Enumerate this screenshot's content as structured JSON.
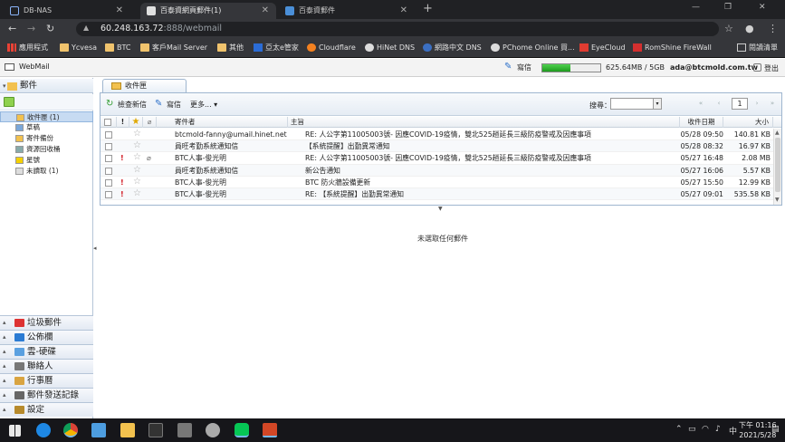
{
  "browser": {
    "tabs": [
      {
        "label": "DB-NAS"
      },
      {
        "label": "百泰資網頁郵件(1)"
      },
      {
        "label": "百泰資郵件"
      }
    ],
    "url_host": "60.248.163.72",
    "url_rest": ":888/webmail",
    "bookmarks": [
      "應用程式",
      "Ycvesa",
      "BTC",
      "客戶Mail Server",
      "其他",
      "亞太e管家",
      "Cloudflare",
      "HiNet DNS",
      "網路中文 DNS",
      "PChome Online 買...",
      "EyeCloud",
      "RomShine FireWall",
      "閱讀清單"
    ]
  },
  "webmail": {
    "title": "WebMail",
    "compose_label": "寫信",
    "quota_text": "625.64MB / 5GB",
    "quota_fraction": 0.12,
    "user_email": "ada@btcmold.com.tw",
    "logout_label": "登出"
  },
  "sidebar": {
    "mail_header": "郵件",
    "folders": [
      {
        "label": "收件匣 (1)",
        "selected": true,
        "color": "#f2c14e"
      },
      {
        "label": "草稿",
        "selected": false,
        "color": "#7aa7d9"
      },
      {
        "label": "寄件備份",
        "selected": false,
        "color": "#f2c14e"
      },
      {
        "label": "資源回收桶",
        "selected": false,
        "color": "#8aa"
      },
      {
        "label": "星號",
        "selected": false,
        "color": "#f5d000"
      },
      {
        "label": "未讀取 (1)",
        "selected": false,
        "color": "#ddd"
      }
    ],
    "sections": [
      "垃圾郵件",
      "公佈欄",
      "雲-硬碟",
      "聯絡人",
      "行事曆",
      "郵件發送記錄",
      "設定"
    ]
  },
  "main": {
    "tab_label": "收件匣",
    "toolbar": {
      "check_label": "檢查新信",
      "compose_label": "寫信",
      "more_label": "更多..."
    },
    "search_label": "搜尋：",
    "page_number": "1",
    "columns": {
      "from": "寄件者",
      "subject": "主旨",
      "date": "收件日期",
      "size": "大小"
    },
    "messages": [
      {
        "from": "btcmold-fanny@umail.hinet.net",
        "subject": "RE: 人公字第11005003號- 因應COVID-19疫情，雙北525趟延長三級防疫警戒及因應事項",
        "date": "05/28 09:50",
        "size": "140.81 KB",
        "priority": false,
        "attach": false
      },
      {
        "from": "員旺考勤系統通知信",
        "subject": "【系統提醒】出勤異常通知",
        "date": "05/28 08:32",
        "size": "16.97 KB",
        "priority": false,
        "attach": false
      },
      {
        "from": "BTC人事-俊光明",
        "subject": "RE: 人公字第11005003號- 因應COVID-19疫情，雙北525趟延長三級防疫警戒及因應事項",
        "date": "05/27 16:48",
        "size": "2.08 MB",
        "priority": true,
        "attach": true
      },
      {
        "from": "員旺考勤系統通知信",
        "subject": "新公告通知",
        "date": "05/27 16:06",
        "size": "5.57 KB",
        "priority": false,
        "attach": false
      },
      {
        "from": "BTC人事-俊光明",
        "subject": "BTC 防火牆設備更新",
        "date": "05/27 15:50",
        "size": "12.99 KB",
        "priority": true,
        "attach": false
      },
      {
        "from": "BTC人事-俊光明",
        "subject": "RE: 【系統提醒】出勤異常通知",
        "date": "05/27 09:01",
        "size": "535.58 KB",
        "priority": true,
        "attach": false
      }
    ],
    "empty_preview": "未選取任何郵件"
  },
  "taskbar": {
    "time": "下午 01:16",
    "date": "2021/5/28",
    "ime": "中"
  }
}
